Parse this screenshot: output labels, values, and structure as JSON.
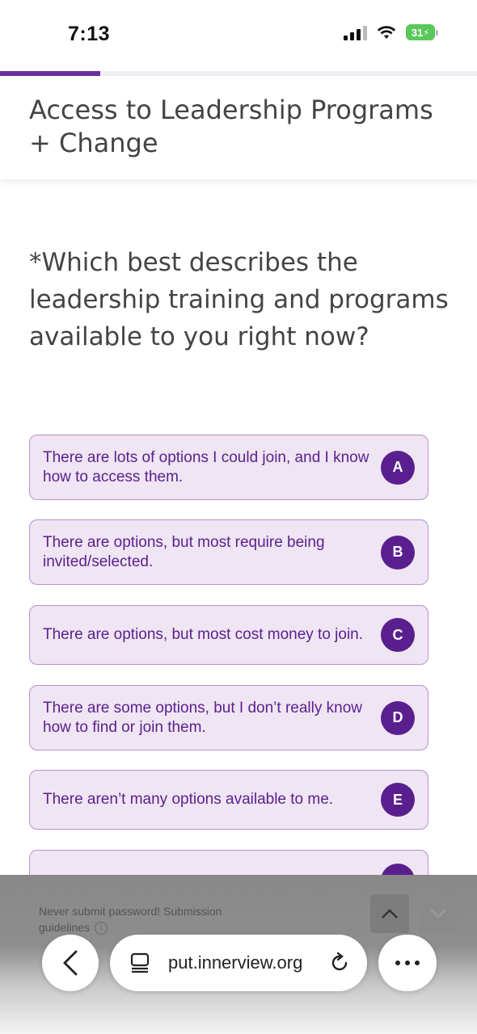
{
  "status_bar": {
    "time": "7:13",
    "battery": "31"
  },
  "progress": {
    "fraction": 0.21,
    "color": "#6b2fa0"
  },
  "header": {
    "title": "Access to Leadership Programs + Change"
  },
  "question": {
    "text": "*Which best describes the leadership training and programs available to you right now?"
  },
  "options": [
    {
      "label": "There are lots of options I could join, and I know how to access them.",
      "key": "A"
    },
    {
      "label": "There are options, but most require being invited/selected.",
      "key": "B"
    },
    {
      "label": "There are options, but most cost money to join.",
      "key": "C"
    },
    {
      "label": "There are some options, but I don’t really know how to find or join them.",
      "key": "D"
    },
    {
      "label": "There aren’t many options available to me.",
      "key": "E"
    }
  ],
  "footer": {
    "guidelines": "Never submit password! Submission guidelines"
  },
  "browser": {
    "url": "put.innerview.org"
  },
  "colors": {
    "accent": "#5a1f8e",
    "option_bg": "#efe5f3",
    "option_border": "#b594cf"
  },
  "icons": [
    "signal-icon",
    "wifi-icon",
    "battery-icon",
    "chevron-up-icon",
    "chevron-down-icon",
    "back-icon",
    "reader-icon",
    "reload-icon",
    "more-icon"
  ]
}
